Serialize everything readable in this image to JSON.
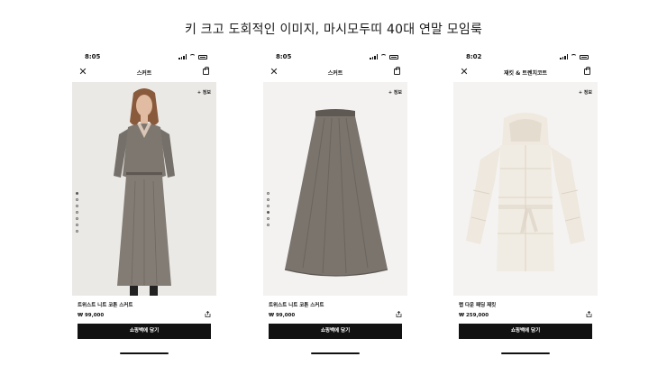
{
  "headline": "키 크고 도회적인 이미지, 마시모두띠 40대 연말 모임룩",
  "icons": {
    "close": "close-icon",
    "bag": "shopping-bag-icon",
    "share": "share-icon",
    "signal": "signal-icon",
    "wifi": "wifi-icon",
    "battery": "battery-icon"
  },
  "screens": [
    {
      "time": "8:05",
      "nav_title": "스커트",
      "info_label": "+ 정보",
      "product_name": "트위스트 니트 코튼 스커트",
      "price": "₩ 99,000",
      "cart_label": "쇼핑백에 담기",
      "image": "model-wearing-gray-knit-dress",
      "gallery_dots": 7,
      "active_dot": 0
    },
    {
      "time": "8:05",
      "nav_title": "스커트",
      "info_label": "+ 정보",
      "product_name": "트위스트 니트 코튼 스커트",
      "price": "₩ 99,000",
      "cart_label": "쇼핑백에 담기",
      "image": "gray-knit-midi-skirt",
      "gallery_dots": 6,
      "active_dot": 3
    },
    {
      "time": "8:02",
      "nav_title": "재킷 & 트렌치코트",
      "info_label": "+ 정보",
      "product_name": "랩 다운 패딩 재킷",
      "price": "₩ 259,000",
      "cart_label": "쇼핑백에 담기",
      "image": "cream-belted-down-jacket",
      "color_swatches": [
        "#8a2b3a",
        "#f4f1ec",
        "#b6a496"
      ]
    }
  ]
}
